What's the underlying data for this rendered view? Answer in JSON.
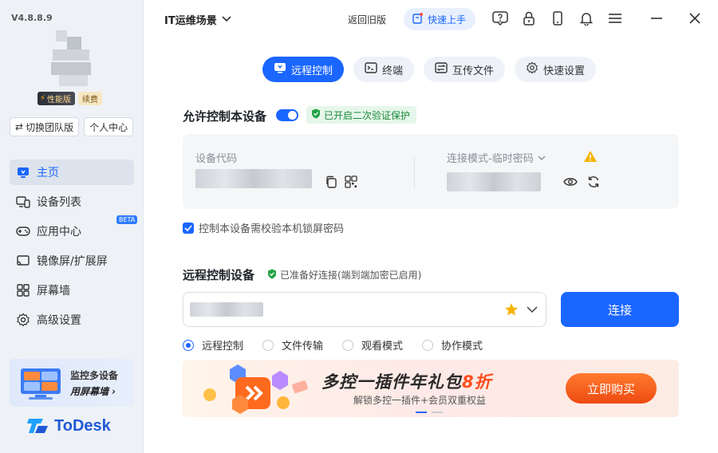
{
  "sidebar": {
    "version": "V4.8.8.9",
    "badge_perf": "性能版",
    "badge_renew": "续费",
    "switch_team": "切换团队版",
    "personal_center": "个人中心",
    "items": [
      {
        "label": "主页",
        "icon": "home-monitor-icon",
        "active": true
      },
      {
        "label": "设备列表",
        "icon": "devices-icon"
      },
      {
        "label": "应用中心",
        "icon": "gamepad-icon",
        "badge": "BETA"
      },
      {
        "label": "镜像屏/扩展屏",
        "icon": "cast-icon"
      },
      {
        "label": "屏幕墙",
        "icon": "grid-icon"
      },
      {
        "label": "高级设置",
        "icon": "gear-icon"
      }
    ],
    "promo_line1": "监控多设备",
    "promo_line2": "用屏幕墙 ›",
    "logo_text": "ToDesk"
  },
  "topbar": {
    "workspace": "IT运维场景",
    "old_version": "返回旧版",
    "quick_start": "快速上手"
  },
  "tabs": [
    {
      "label": "远程控制",
      "icon": "monitor-icon",
      "active": true
    },
    {
      "label": "终端",
      "icon": "terminal-icon"
    },
    {
      "label": "互传文件",
      "icon": "transfer-icon"
    },
    {
      "label": "快速设置",
      "icon": "gear-icon"
    }
  ],
  "allow": {
    "title": "允许控制本设备",
    "verify_badge": "已开启二次验证保护",
    "device_code_label": "设备代码",
    "mode_label": "连接模式-临时密码",
    "lock_check_label": "控制本设备需校验本机锁屏密码"
  },
  "remote": {
    "title": "远程控制设备",
    "ready_text": "已准备好连接(端到端加密已启用)",
    "connect_label": "连接",
    "modes": [
      {
        "label": "远程控制",
        "selected": true
      },
      {
        "label": "文件传输",
        "selected": false
      },
      {
        "label": "观看模式",
        "selected": false
      },
      {
        "label": "协作模式",
        "selected": false
      }
    ]
  },
  "banner": {
    "title_a": "多控一插件年礼包",
    "title_b": "8折",
    "subtitle": "解锁多控一插件+会员双重权益",
    "buy_label": "立即购买"
  },
  "colors": {
    "accent": "#1a66ff",
    "success": "#1a8a3a",
    "promo": "#ff4d1f"
  }
}
